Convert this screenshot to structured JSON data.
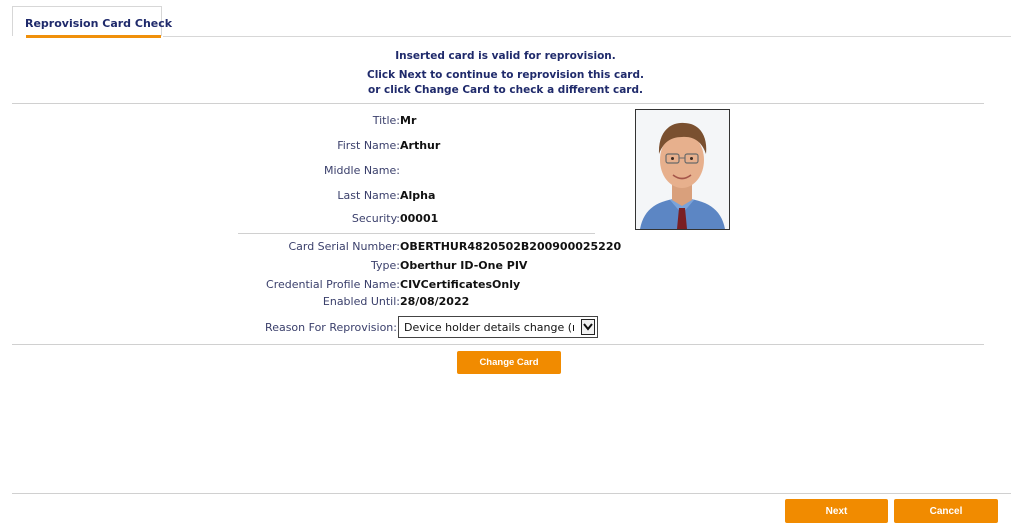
{
  "tab": {
    "label": "Reprovision Card Check"
  },
  "messages": {
    "line1": "Inserted card is valid for reprovision.",
    "line2": "Click Next to continue to reprovision this card.",
    "line3": "or click Change Card to check a different card."
  },
  "person": {
    "title_label": "Title:",
    "title_value": "Mr",
    "first_name_label": "First Name:",
    "first_name_value": "Arthur",
    "middle_name_label": "Middle Name:",
    "middle_name_value": "",
    "last_name_label": "Last Name:",
    "last_name_value": "Alpha",
    "security_label": "Security:",
    "security_value": "00001"
  },
  "card": {
    "serial_label": "Card Serial Number:",
    "serial_value": "OBERTHUR4820502B200900025220",
    "type_label": "Type:",
    "type_value": "Oberthur ID-One PIV",
    "profile_label": "Credential Profile Name:",
    "profile_value": "CIVCertificatesOnly",
    "enabled_label": "Enabled Until:",
    "enabled_value": "28/08/2022"
  },
  "reason": {
    "label": "Reason For Reprovision:",
    "selected": "Device holder details change (rev"
  },
  "buttons": {
    "change_card": "Change Card",
    "next": "Next",
    "cancel": "Cancel"
  },
  "colors": {
    "accent": "#f18b00",
    "text": "#1f2a6b"
  }
}
